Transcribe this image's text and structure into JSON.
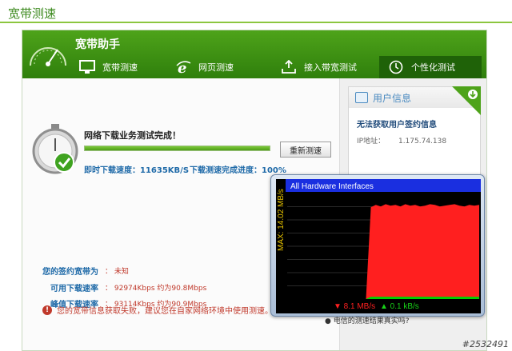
{
  "page": {
    "title": "宽带测速",
    "watermark": "#2532491"
  },
  "app": {
    "title": "宽带助手"
  },
  "tabs": [
    {
      "label": "宽带测速",
      "icon": "monitor-icon",
      "active": false
    },
    {
      "label": "网页测速",
      "icon": "browser-e-icon",
      "active": false
    },
    {
      "label": "接入带宽测试",
      "icon": "upload-tray-icon",
      "active": false
    },
    {
      "label": "个性化测试",
      "icon": "clock-icon",
      "active": true
    }
  ],
  "test": {
    "done_text": "网络下载业务测试完成！",
    "progress": 1.0,
    "retest_label": "重新测速",
    "instant_speed": "即时下载速度：11635KB/S",
    "progress_text": "下载测速完成进度：100%"
  },
  "bandwidth": {
    "signed_label": "您的签约宽带为",
    "signed_value": "：  未知",
    "available_label": "可用下载速率",
    "available_value": "：  92974Kbps     约为90.8Mbps",
    "peak_label": "峰值下载速率",
    "peak_value": "：  93114Kbps     约为90.9Mbps"
  },
  "warning": {
    "text": "您的宽带信息获取失败，建议您在自家网络环境中使用测速。"
  },
  "user_info": {
    "title": "用户信息",
    "message": "无法获取用户签约信息",
    "ip_label": "IP地址：",
    "ip_value": "1.175.74.138"
  },
  "note": "● 电信的测速结果真实吗?",
  "monitor": {
    "title": "All Hardware Interfaces",
    "max_label": "MAX: 14.02 MB/s",
    "down_label": "▼ 8.1 MB/s",
    "up_label": "▲ 0.1 kB/s",
    "colors": {
      "download": "#ff1f1f",
      "upload": "#00d000",
      "title_bar": "#1a2fe0",
      "max_text": "#e8c400"
    }
  },
  "chart_data": {
    "type": "area",
    "title": "All Hardware Interfaces",
    "ylabel": "MAX: 14.02 MB/s",
    "ylim": [
      0,
      14.02
    ],
    "x": [
      0,
      1,
      2,
      3,
      4,
      5,
      6,
      7,
      8,
      9,
      10,
      11,
      12,
      13,
      14,
      15,
      16,
      17,
      18,
      19,
      20,
      21,
      22,
      23,
      24,
      25,
      26,
      27,
      28,
      29,
      30,
      31,
      32,
      33,
      34,
      35,
      36,
      37,
      38,
      39
    ],
    "series": [
      {
        "name": "▼ 8.1 MB/s",
        "values": [
          0,
          0,
          0,
          0,
          0,
          0,
          0,
          0,
          0,
          0,
          0,
          0,
          0,
          0,
          0,
          0,
          0,
          12.2,
          12.5,
          12.3,
          12.6,
          12.4,
          12.5,
          12.3,
          12.6,
          12.4,
          12.5,
          12.3,
          12.4,
          12.6,
          12.5,
          12.3,
          12.4,
          12.5,
          12.6,
          12.4,
          12.3,
          12.5,
          12.4,
          12.5
        ]
      },
      {
        "name": "▲ 0.1 kB/s",
        "values": [
          0,
          0,
          0,
          0,
          0,
          0,
          0,
          0,
          0,
          0,
          0,
          0,
          0,
          0,
          0,
          0,
          0,
          0.3,
          0.3,
          0.3,
          0.3,
          0.3,
          0.3,
          0.3,
          0.3,
          0.3,
          0.3,
          0.3,
          0.3,
          0.3,
          0.3,
          0.3,
          0.3,
          0.3,
          0.3,
          0.3,
          0.3,
          0.3,
          0.3,
          0.3
        ]
      }
    ]
  }
}
